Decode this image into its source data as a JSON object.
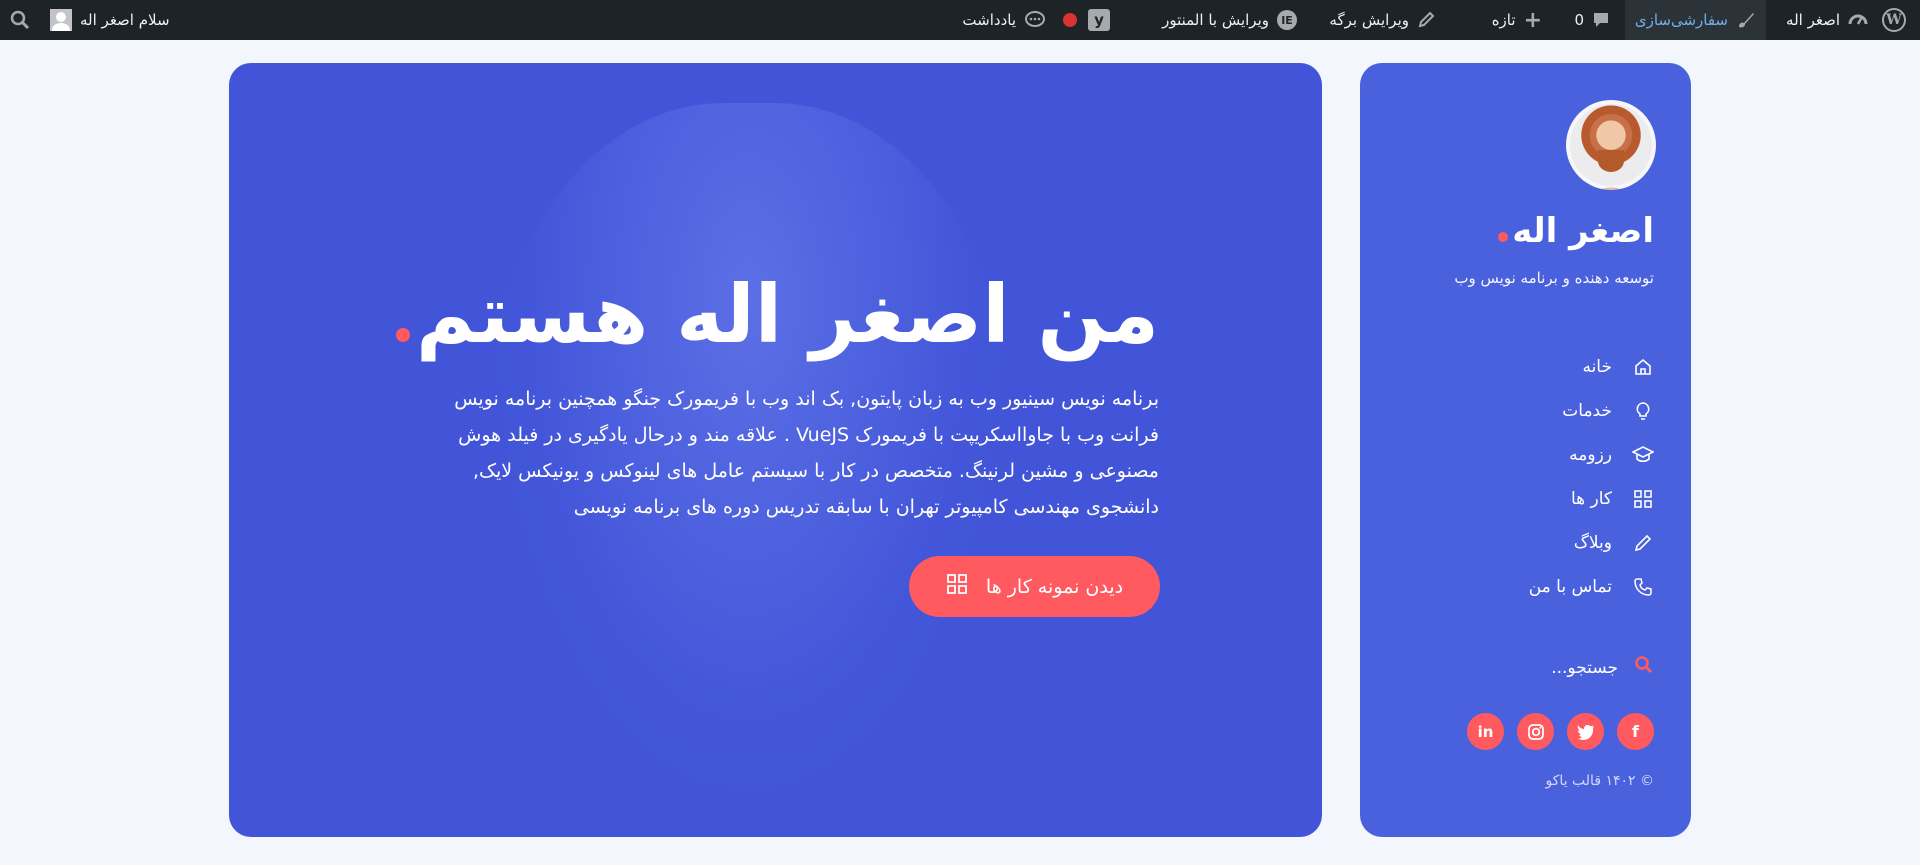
{
  "adminbar": {
    "site_name": "اصغر اله",
    "customize": "سفارشی‌سازی",
    "comments_count": "0",
    "new_label": "تازه",
    "edit_page": "ویرایش برگه",
    "edit_elementor": "ویرایش با المنتور",
    "notes": "یادداشت",
    "greeting": "سلام اصغر اله"
  },
  "sidebar": {
    "name": "اصغر اله",
    "tagline": "توسعه دهنده و برنامه نویس وب",
    "nav": [
      {
        "label": "خانه",
        "icon": "home-icon"
      },
      {
        "label": "خدمات",
        "icon": "lightbulb-icon"
      },
      {
        "label": "رزومه",
        "icon": "graduation-cap-icon"
      },
      {
        "label": "کار ها",
        "icon": "grid-icon"
      },
      {
        "label": "وبلاگ",
        "icon": "pencil-icon"
      },
      {
        "label": "تماس با من",
        "icon": "phone-icon"
      }
    ],
    "search_label": "جستجو...",
    "socials": [
      "facebook-icon",
      "twitter-icon",
      "instagram-icon",
      "linkedin-icon"
    ],
    "copyright": "© ۱۴۰۲ قالب یاکو"
  },
  "hero": {
    "title": "من اصغر اله هستم",
    "description": "برنامه نویس سینیور وب به زبان پایتون, بک اند وب با فریمورک جنگو همچنین برنامه نویس فرانت وب با جاوااسکریپت با فریمورک VueJS . علاقه مند و درحال یادگیری در فیلد هوش مصنوعی و مشین لرنینگ. متخصص در کار با سیستم عامل های لینوکس و یونیکس لایک, دانشجوی مهندسی کامپیوتر تهران با سابقه تدریس دوره های برنامه نویسی",
    "cta_label": "دیدن نمونه کار ها"
  },
  "colors": {
    "accent": "#ff5a5f",
    "sidebar_bg": "#4a61dd",
    "hero_bg": "#4255d8",
    "adminbar_bg": "#1d2327"
  }
}
